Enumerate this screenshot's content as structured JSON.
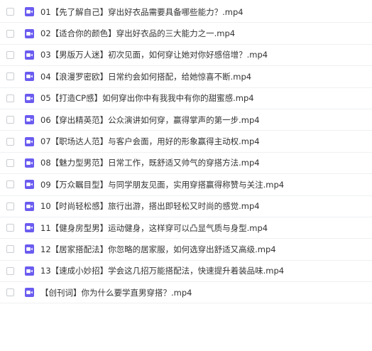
{
  "files": [
    {
      "name": "01【先了解自己】穿出好衣品需要具备哪些能力？.mp4",
      "icon": "video-file-icon"
    },
    {
      "name": "02【适合你的颜色】穿出好衣品的三大能力之一.mp4",
      "icon": "video-file-icon"
    },
    {
      "name": "03【男版万人迷】初次见面，如何穿让她对你好感倍增？.mp4",
      "icon": "video-file-icon"
    },
    {
      "name": "04【浪漫罗密欧】日常约会如何搭配，给她惊喜不断.mp4",
      "icon": "video-file-icon"
    },
    {
      "name": "05【打造CP感】如何穿出你中有我我中有你的甜蜜感.mp4",
      "icon": "video-file-icon"
    },
    {
      "name": "06【穿出精英范】公众演讲如何穿，赢得掌声的第一步.mp4",
      "icon": "video-file-icon"
    },
    {
      "name": "07【职场达人范】与客户会面，用好的形象赢得主动权.mp4",
      "icon": "video-file-icon"
    },
    {
      "name": "08【魅力型男范】日常工作，既舒适又帅气的穿搭方法.mp4",
      "icon": "video-file-icon"
    },
    {
      "name": "09【万众瞩目型】与同学朋友见面，实用穿搭赢得称赞与关注.mp4",
      "icon": "video-file-icon"
    },
    {
      "name": "10【时尚轻松感】旅行出游，搭出即轻松又时尚的感觉.mp4",
      "icon": "video-file-icon"
    },
    {
      "name": "11【健身房型男】运动健身，这样穿可以凸显气质与身型.mp4",
      "icon": "video-file-icon"
    },
    {
      "name": "12【居家搭配法】你忽略的居家服，如何选穿出舒适又高级.mp4",
      "icon": "video-file-icon"
    },
    {
      "name": "13【速成小妙招】学会这几招万能搭配法，快速提升着装品味.mp4",
      "icon": "video-file-icon"
    },
    {
      "name": "【创刊词】你为什么要学直男穿搭？.mp4",
      "icon": "video-file-icon"
    }
  ],
  "colors": {
    "icon_accent": "#6b5cf0",
    "text": "#333333",
    "divider": "#eef0f2"
  }
}
